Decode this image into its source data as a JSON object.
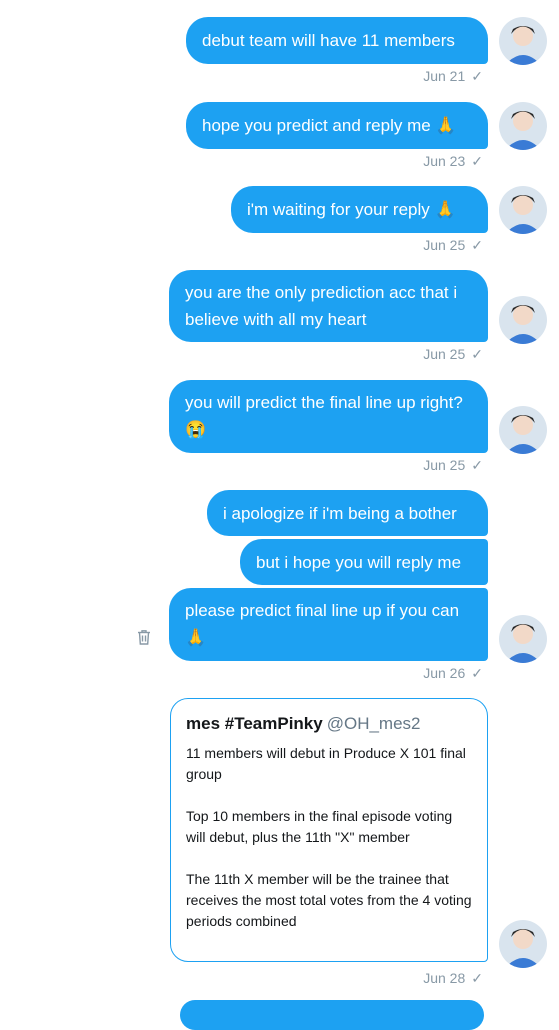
{
  "colors": {
    "accent": "#1da1f2",
    "timestamp": "#8899a6"
  },
  "messages": [
    {
      "text": "debut team will have 11 members",
      "time": "Jun 21"
    },
    {
      "text": "hope you predict and reply me 🙏",
      "time": "Jun 23"
    },
    {
      "text": "i'm waiting for your reply 🙏",
      "time": "Jun 25"
    },
    {
      "text": "you are the only prediction acc that i believe with all my heart",
      "time": "Jun 25"
    },
    {
      "text": "you will predict the final line up right? 😭",
      "time": "Jun 25"
    },
    {
      "text": "i apologize if i'm being a bother"
    },
    {
      "text": "but i hope you will reply me"
    },
    {
      "text": "please predict final line up if you can 🙏",
      "time": "Jun 26"
    }
  ],
  "tweet": {
    "name": "mes #TeamPinky",
    "handle": "@OH_mes2",
    "paragraphs": [
      "11 members will debut in Produce X 101 final group",
      "Top 10 members in the final episode voting will debut, plus the 11th \"X\" member",
      "The 11th X member will be the trainee that receives the most total votes from the 4 voting periods combined"
    ],
    "time": "Jun 28"
  },
  "icons": {
    "read": "checkmark-icon",
    "delete": "trash-icon",
    "avatar": "avatar"
  }
}
